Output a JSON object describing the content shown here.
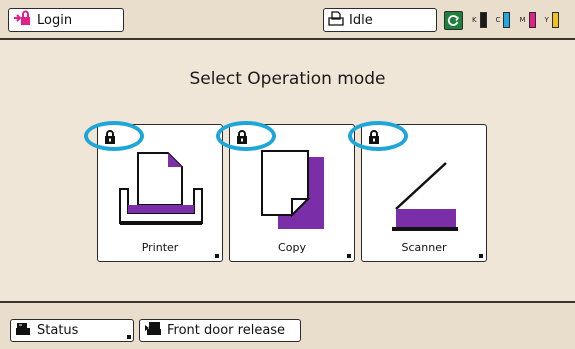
{
  "topbar": {
    "login_label": "Login",
    "status_label": "Idle",
    "ink": [
      {
        "letter": "K",
        "color": "#1a1a1a"
      },
      {
        "letter": "C",
        "color": "#23a7dd"
      },
      {
        "letter": "M",
        "color": "#e0218a"
      },
      {
        "letter": "Y",
        "color": "#f2c21b"
      }
    ]
  },
  "main": {
    "title": "Select Operation mode",
    "modes": [
      {
        "label": "Printer",
        "icon": "printer-icon",
        "locked": true
      },
      {
        "label": "Copy",
        "icon": "copy-icon",
        "locked": true
      },
      {
        "label": "Scanner",
        "icon": "scanner-icon",
        "locked": true
      }
    ]
  },
  "bottombar": {
    "status_label": "Status",
    "front_door_label": "Front door release"
  },
  "colors": {
    "accent_purple": "#7a2fa8",
    "highlight_blue": "#1fa6d8",
    "background": "#efe6d8",
    "login_icon": "#e0218a"
  }
}
